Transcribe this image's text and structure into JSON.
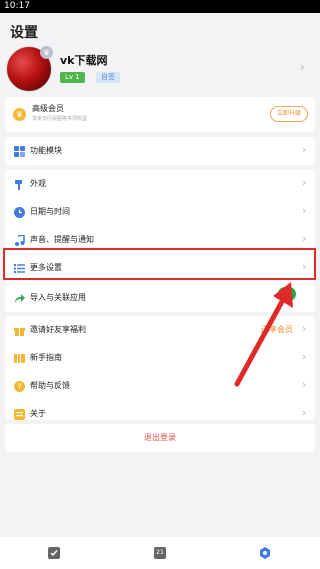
{
  "status_bar": {
    "time": "10:17"
  },
  "page_title": "设置",
  "profile": {
    "username": "vk下载网",
    "level_badge": "Lv 1",
    "tag_badge": "自签"
  },
  "vip": {
    "title": "高级会员",
    "subtitle": "享受日历视图等多项权益",
    "upgrade_button": "立即升级"
  },
  "sections": {
    "modules": {
      "label": "功能模块"
    },
    "appearance": {
      "label": "外观"
    },
    "datetime": {
      "label": "日期与时间"
    },
    "sound": {
      "label": "声音、提醒与通知"
    },
    "more": {
      "label": "更多设置"
    },
    "import": {
      "label": "导入与关联应用"
    },
    "invite": {
      "label": "邀请好友享福利",
      "tag": "送享会员"
    },
    "guide": {
      "label": "新手指南"
    },
    "help": {
      "label": "帮助与反馈"
    },
    "about": {
      "label": "关于"
    }
  },
  "logout": {
    "label": "退出登录"
  },
  "tabbar": {
    "calendar_day": "21"
  },
  "colors": {
    "accent_orange": "#f08a2a",
    "highlight_red": "#e02a2a",
    "logout_red": "#e25050"
  }
}
